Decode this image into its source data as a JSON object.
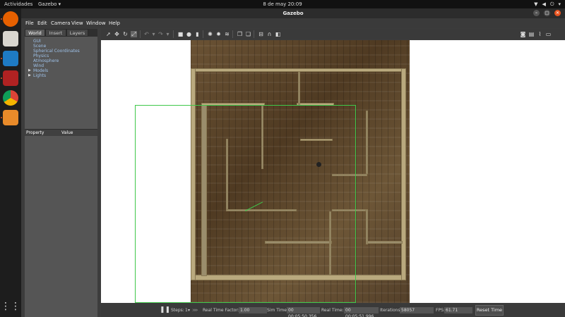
{
  "topbar": {
    "activities": "Actividades",
    "app_menu": "Gazebo",
    "clock": "8 de may  20:09",
    "tray_icons": [
      "network-icon",
      "volume-icon",
      "power-icon"
    ]
  },
  "dock": {
    "apps": [
      "firefox-icon",
      "files-icon",
      "vscode-icon",
      "terminal-icon",
      "chrome-icon",
      "gazebo-icon",
      "app-grid-icon"
    ]
  },
  "window": {
    "title": "Gazebo",
    "menu": [
      "File",
      "Edit",
      "Camera",
      "View",
      "Window",
      "Help"
    ]
  },
  "left_panel": {
    "tabs": [
      "World",
      "Insert",
      "Layers"
    ],
    "active_tab": "World",
    "tree": [
      "GUI",
      "Scene",
      "Spherical Coordinates",
      "Physics",
      "Atmosphere",
      "Wind",
      "Models",
      "Lights"
    ],
    "property_header": "Property",
    "value_header": "Value"
  },
  "status": {
    "steps_label": "Steps:",
    "steps_value": "1",
    "rtf_label": "Real Time Factor:",
    "rtf_value": "1.00",
    "sim_time_label": "Sim Time:",
    "sim_time_value": "00 00:05:50.356",
    "real_time_label": "Real Time:",
    "real_time_value": "00 00:05:51.996",
    "iterations_label": "Iterations:",
    "iterations_value": "58057",
    "fps_label": "FPS:",
    "fps_value": "61.71",
    "reset_label": "Reset Time"
  },
  "colors": {
    "accent": "#e95420",
    "selection": "#3fc84a"
  }
}
